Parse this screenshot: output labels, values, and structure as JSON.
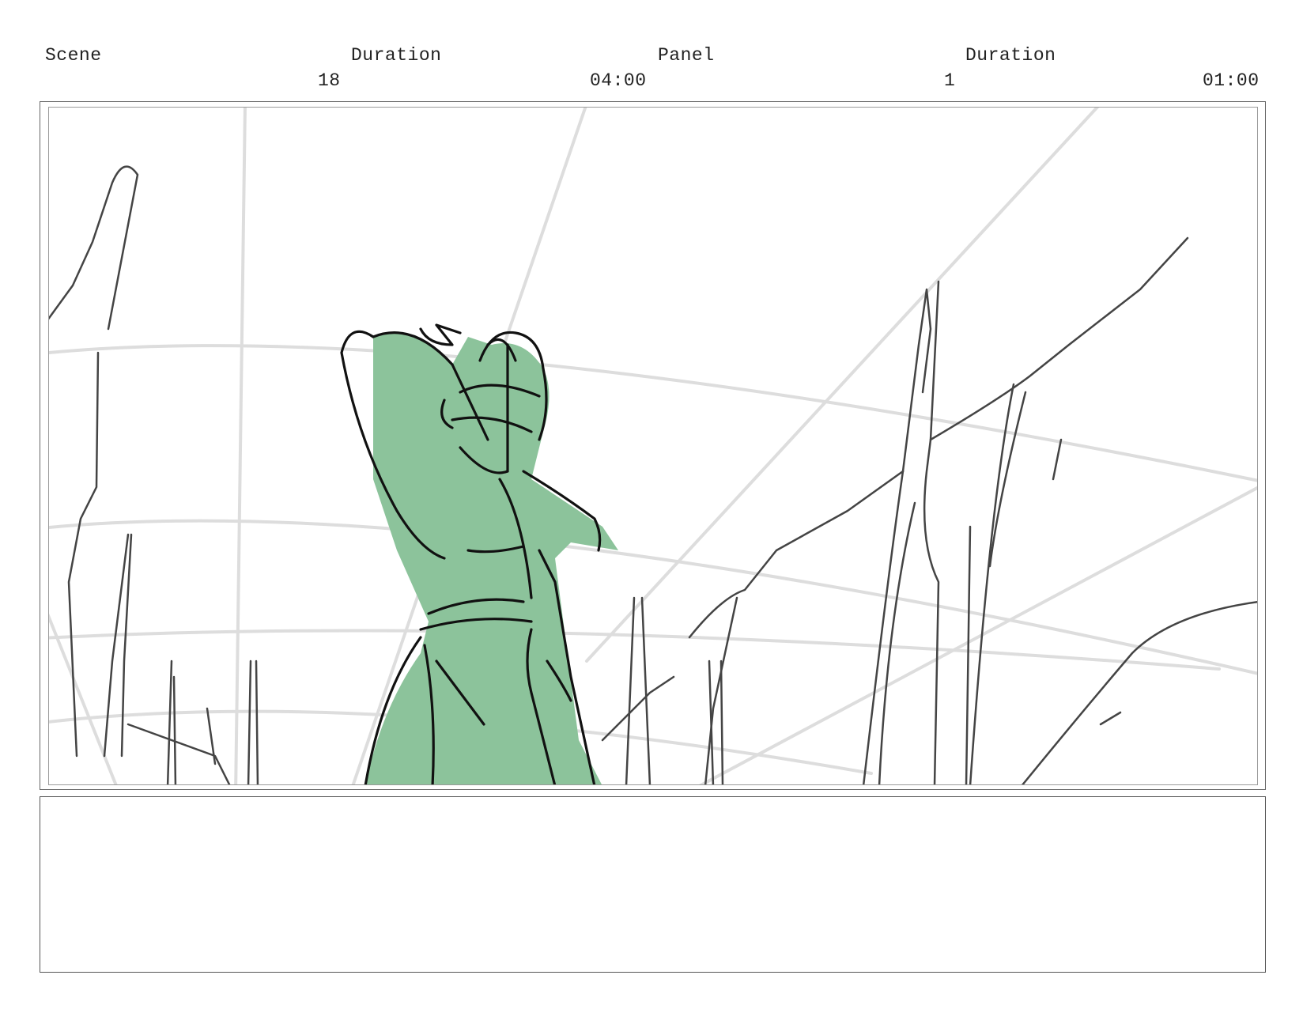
{
  "header": {
    "scene_label": "Scene",
    "scene_duration_label": "Duration",
    "panel_label": "Panel",
    "panel_duration_label": "Duration"
  },
  "values": {
    "scene": "18",
    "scene_duration": "04:00",
    "panel": "1",
    "panel_duration": "01:00"
  },
  "colors": {
    "figure_fill": "#8cc39b",
    "line_dark": "#111111",
    "line_grey": "#444444",
    "guide_lines": "#dddddd",
    "frame_border": "#666666"
  },
  "notes": {
    "text": ""
  }
}
